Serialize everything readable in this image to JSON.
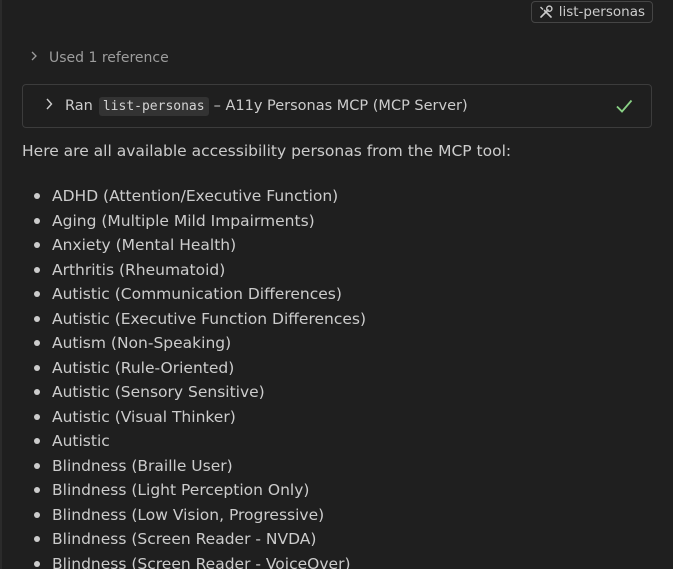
{
  "tool_chip": {
    "icon": "tools-icon",
    "label": "list-personas"
  },
  "references": {
    "label": "Used 1 reference",
    "icon": "chevron-right-icon"
  },
  "tool_call": {
    "prefix": "Ran",
    "tool_name": "list-personas",
    "suffix": "– A11y Personas MCP (MCP Server)",
    "status_icon": "checkmark-icon",
    "status_color": "#89d185"
  },
  "response": {
    "intro": "Here are all available accessibility personas from the MCP tool:",
    "personas": [
      "ADHD (Attention/Executive Function)",
      "Aging (Multiple Mild Impairments)",
      "Anxiety (Mental Health)",
      "Arthritis (Rheumatoid)",
      "Autistic (Communication Differences)",
      "Autistic (Executive Function Differences)",
      "Autism (Non-Speaking)",
      "Autistic (Rule-Oriented)",
      "Autistic (Sensory Sensitive)",
      "Autistic (Visual Thinker)",
      "Autistic",
      "Blindness (Braille User)",
      "Blindness (Light Perception Only)",
      "Blindness (Low Vision, Progressive)",
      "Blindness (Screen Reader - NVDA)",
      "Blindness (Screen Reader - VoiceOver)"
    ]
  }
}
